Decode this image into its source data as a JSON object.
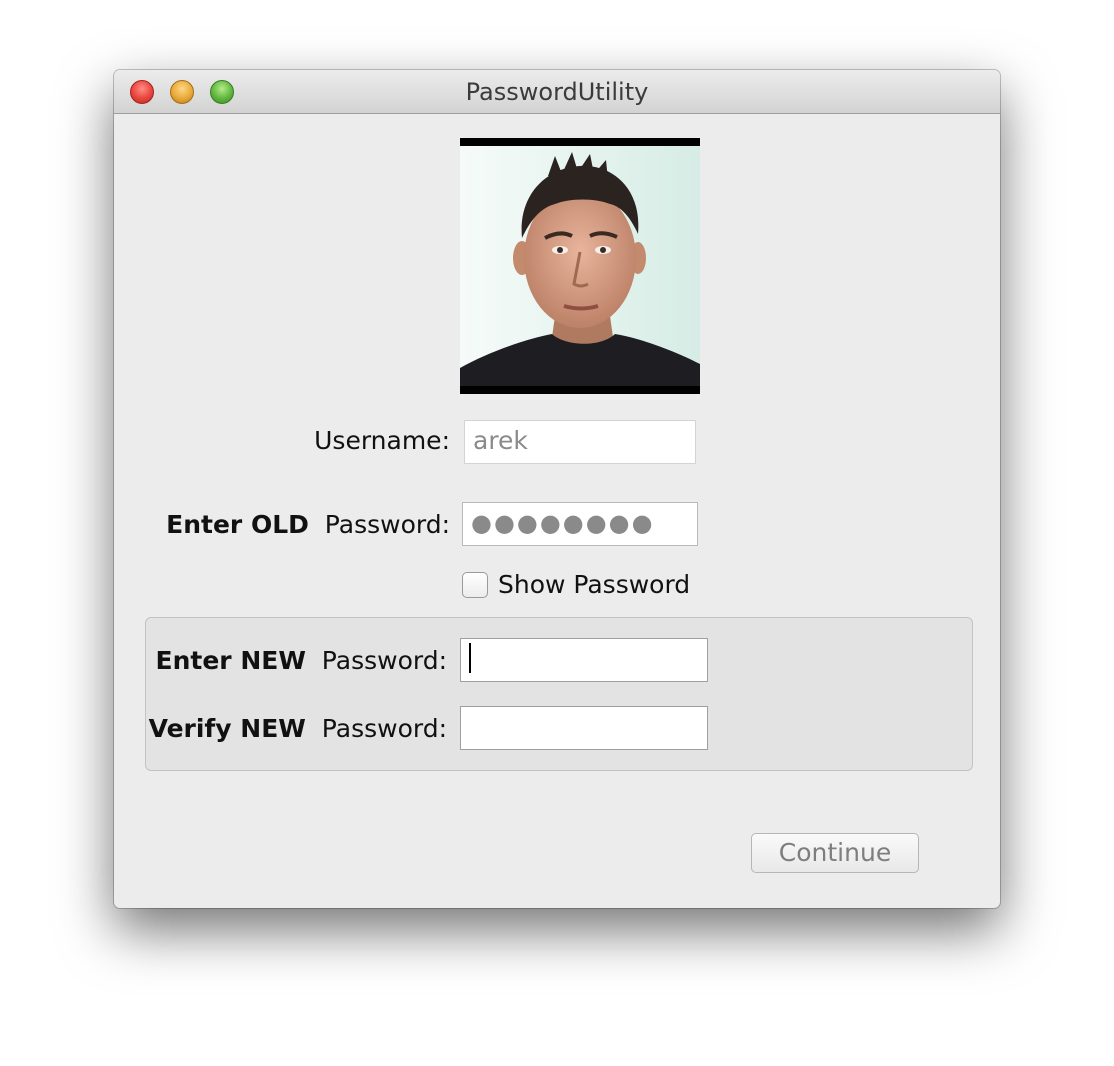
{
  "window": {
    "title": "PasswordUtility"
  },
  "profile": {
    "photo_icon": "user-portrait"
  },
  "form": {
    "username_label": "Username:",
    "username_value": "arek",
    "old_password_label_bold": "Enter OLD",
    "old_password_label_rest": "Password:",
    "old_password_masked": "●●●●●●●●",
    "show_password_label": "Show Password",
    "new_password_label_bold": "Enter NEW",
    "new_password_label_rest": "Password:",
    "verify_password_label_bold": "Verify NEW",
    "verify_password_label_rest": "Password:"
  },
  "actions": {
    "continue_label": "Continue"
  },
  "colors": {
    "window_bg": "#ececec",
    "close_button": "#e8453c",
    "minimize_button": "#e9a93a",
    "zoom_button": "#60b63f"
  }
}
